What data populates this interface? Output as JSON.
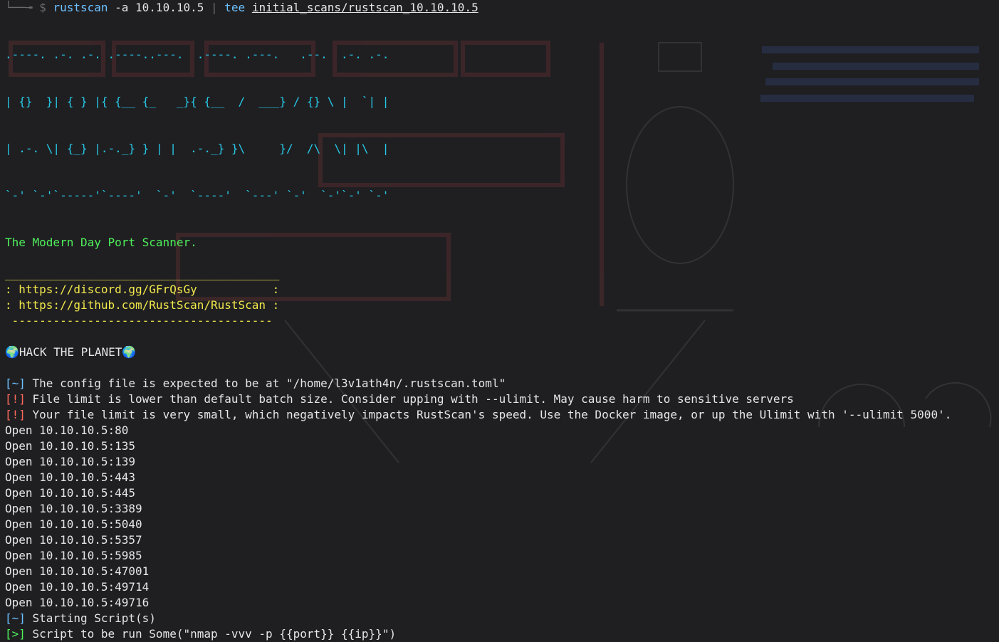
{
  "command_line": {
    "prefix": "└──╼ $ ",
    "binary": "rustscan",
    "arg_flag": " -a ",
    "ip": "10.10.10.5",
    "pipe": " | ",
    "tee_bin": "tee",
    "tee_path": "initial_scans/rustscan_10.10.10.5"
  },
  "banner": [
    ".----. .-. .-. .----..---.  .----. .---.   .--.  .-. .-.",
    "| {}  }| { } |{ {__ {_   _}{ {__  /  ___} / {} \\ |  `| |",
    "| .-. \\| {_} |.-._} } | |  .-._} }\\     }/  /\\  \\| |\\  |",
    "`-' `-'`-----'`----'  `-'  `----'  `---' `-'  `-'`-' `-'"
  ],
  "tagline": "The Modern Day Port Scanner.",
  "link_box": {
    "top_border": "________________________________________",
    "discord": ": https://discord.gg/GFrQsGy           :",
    "github": ": https://github.com/RustScan/RustScan :",
    "bottom_border": " --------------------------------------"
  },
  "hack_line": {
    "globe_left": "🌍",
    "text": "HACK THE PLANET",
    "globe_right": "🌍"
  },
  "messages": [
    {
      "bracket": "[~]",
      "text": " The config file is expected to be at \"/home/l3v1ath4n/.rustscan.toml\""
    },
    {
      "bracket": "[!]",
      "text": " File limit is lower than default batch size. Consider upping with --ulimit. May cause harm to sensitive servers"
    },
    {
      "bracket": "[!]",
      "text": " Your file limit is very small, which negatively impacts RustScan's speed. Use the Docker image, or up the Ulimit with '--ulimit 5000'."
    }
  ],
  "open_ports": [
    "Open 10.10.10.5:80",
    "Open 10.10.10.5:135",
    "Open 10.10.10.5:139",
    "Open 10.10.10.5:443",
    "Open 10.10.10.5:445",
    "Open 10.10.10.5:3389",
    "Open 10.10.10.5:5040",
    "Open 10.10.10.5:5357",
    "Open 10.10.10.5:5985",
    "Open 10.10.10.5:47001",
    "Open 10.10.10.5:49714",
    "Open 10.10.10.5:49716"
  ],
  "footer": [
    {
      "bracket": "[~]",
      "text": " Starting Script(s)"
    },
    {
      "bracket": "[>]",
      "text": " Script to be run Some(\"nmap -vvv -p {{port}} {{ip}}\")"
    }
  ],
  "colors": {
    "background": "#1f1f22",
    "cyan": "#27c8e6",
    "green": "#4ff05a",
    "yellow": "#f2e84a",
    "blue": "#6ec1ff"
  }
}
